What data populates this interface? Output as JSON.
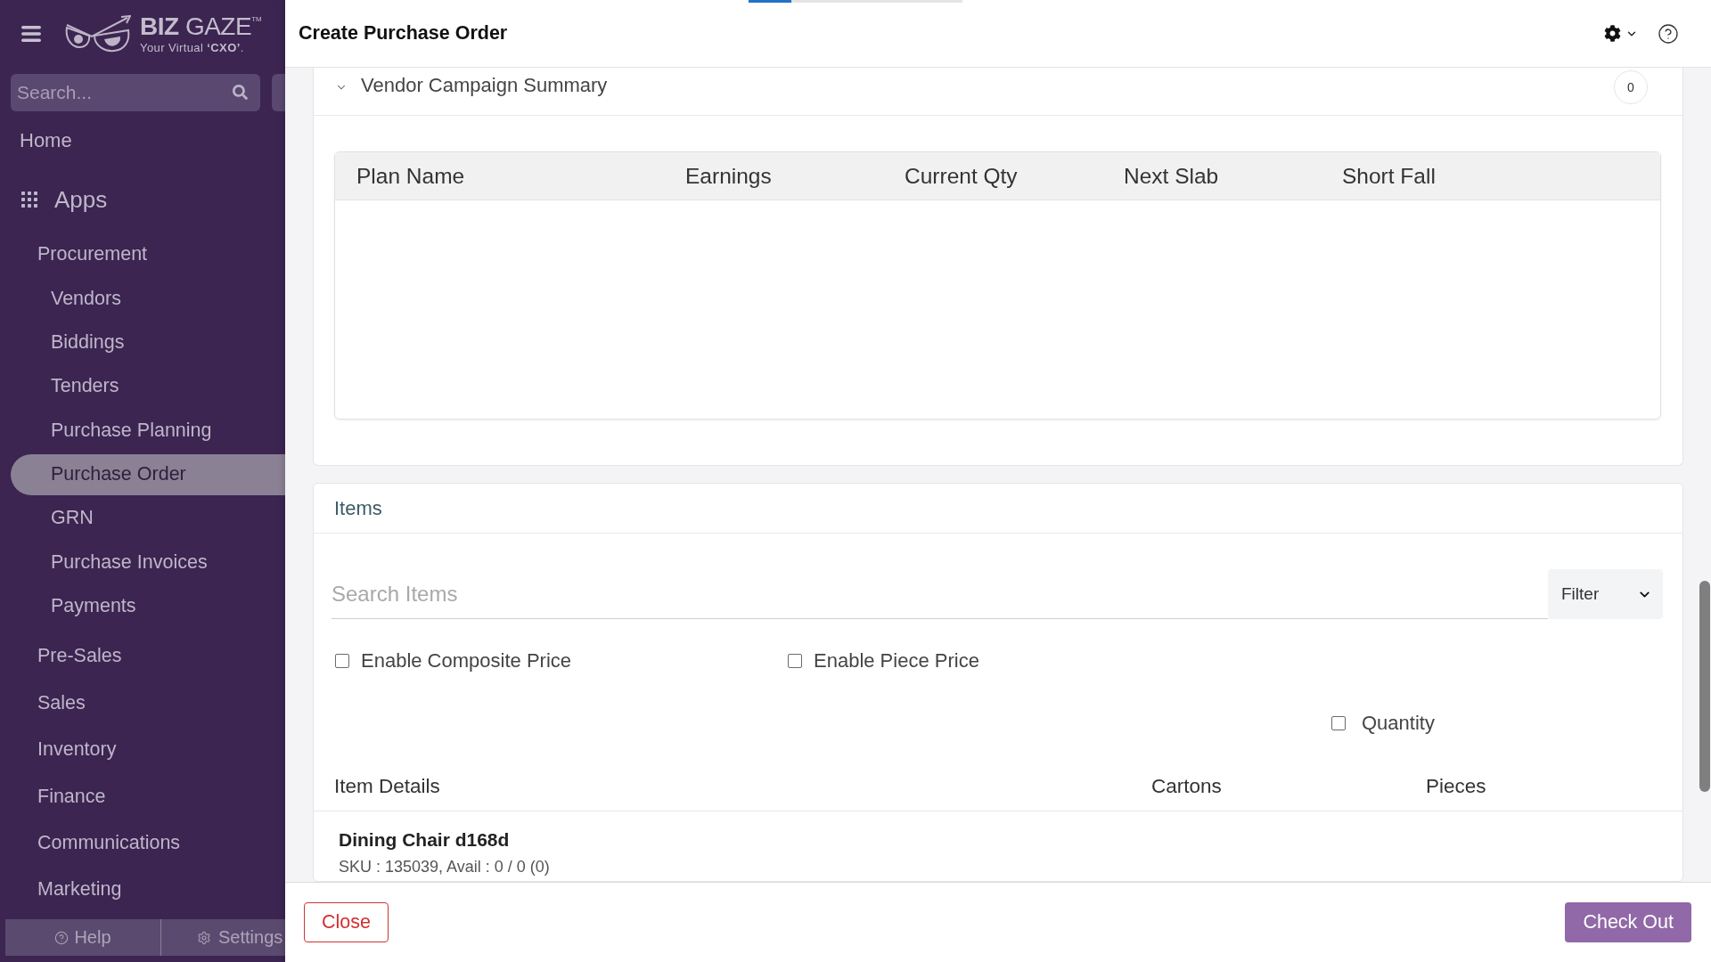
{
  "sidebar": {
    "logo": {
      "brand": "**BIZ** GAZE$^{TM}$",
      "tagline": "Your Virtual **‘CXO’**."
    },
    "search": {
      "placeholder": "Search..."
    },
    "nav": [
      {
        "kind": "link",
        "label": "Home",
        "selected": false
      },
      {
        "kind": "group",
        "label": "Apps",
        "selected": false,
        "children": [
          {
            "label": "Procurement",
            "selected": false,
            "children": [
              {
                "label": "Vendors",
                "selected": false
              },
              {
                "label": "Biddings",
                "selected": false
              },
              {
                "label": "Tenders",
                "selected": false
              },
              {
                "label": "Purchase Planning",
                "selected": false
              },
              {
                "label": "Purchase Order",
                "selected": true
              },
              {
                "label": "GRN",
                "selected": false
              },
              {
                "label": "Purchase Invoices",
                "selected": false
              },
              {
                "label": "Payments",
                "selected": false
              }
            ]
          },
          {
            "label": "Pre-Sales",
            "selected": false
          },
          {
            "label": "Sales",
            "selected": false
          },
          {
            "label": "Inventory",
            "selected": false
          },
          {
            "label": "Finance",
            "selected": false
          },
          {
            "label": "Communications",
            "selected": false
          },
          {
            "label": "Marketing",
            "selected": false
          }
        ]
      }
    ],
    "footer": [
      {
        "kind": "help",
        "label": "Help"
      },
      {
        "kind": "settings",
        "label": "Settings"
      }
    ]
  },
  "dialog": {
    "title": "Create Purchase Order",
    "progress": {
      "level": 0.2
    },
    "campaign_summary": {
      "title": "Vendor Campaign Summary",
      "expanded": true,
      "count": "0",
      "table": {
        "columns": [
          "Plan Name",
          "Earnings",
          "Current Qty",
          "Next Slab",
          "Short Fall"
        ]
      }
    },
    "items": {
      "title": "Items",
      "search": {
        "placeholder": "Search Items"
      },
      "filter": {
        "value": "Filter"
      },
      "options": [
        {
          "label": "Enable Composite Price",
          "checked": false
        },
        {
          "label": "Enable Piece Price",
          "checked": false
        }
      ],
      "column_options": [
        {
          "label": "Quantity",
          "checked": false
        }
      ],
      "table": {
        "columns": [
          "Item Details",
          "Cartons",
          "Pieces"
        ],
        "rows": [
          {
            "name": "Dining Chair d168d",
            "details": "SKU : 135039, Avail : 0 / 0 (0)"
          }
        ]
      }
    },
    "buttons": [
      {
        "kind": "secondary",
        "label": "Close"
      },
      {
        "kind": "primary",
        "label": "Check Out"
      }
    ]
  }
}
